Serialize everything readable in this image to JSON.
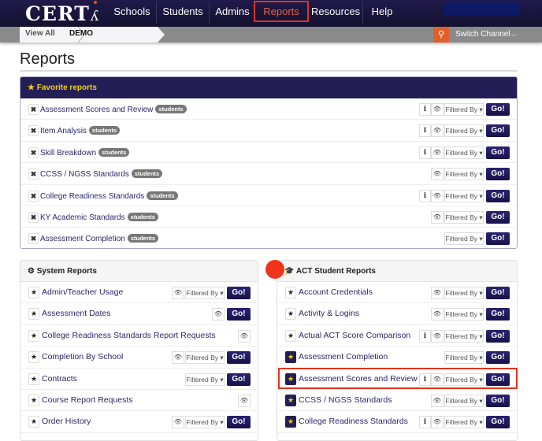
{
  "nav": {
    "logo": "CERT",
    "items": [
      "Schools",
      "Students",
      "Admins",
      "Reports",
      "Resources",
      "Help"
    ],
    "active": "Reports"
  },
  "breadcrumb": [
    "View All",
    "DEMO"
  ],
  "toolbar": {
    "search_icon": "search-icon",
    "switch_channel": "Switch Channel"
  },
  "page_title": "Reports",
  "favorites": {
    "title": "Favorite reports",
    "rows": [
      {
        "name": "Assessment Scores and Review",
        "badge": "students",
        "info": true,
        "eye": true,
        "filter": "Filtered By",
        "go": "Go!"
      },
      {
        "name": "Item Analysis",
        "badge": "students",
        "info": true,
        "eye": true,
        "filter": "Filtered By",
        "go": "Go!"
      },
      {
        "name": "Skill Breakdown",
        "badge": "students",
        "info": true,
        "eye": true,
        "filter": "Filtered By",
        "go": "Go!"
      },
      {
        "name": "CCSS / NGSS Standards",
        "badge": "students",
        "info": false,
        "eye": true,
        "filter": "Filtered By",
        "go": "Go!"
      },
      {
        "name": "College Readiness Standards",
        "badge": "students",
        "info": true,
        "eye": true,
        "filter": "Filtered By",
        "go": "Go!"
      },
      {
        "name": "KY Academic Standards",
        "badge": "students",
        "info": false,
        "eye": true,
        "filter": "Filtered By",
        "go": "Go!"
      },
      {
        "name": "Assessment Completion",
        "badge": "students",
        "info": false,
        "eye": false,
        "filter": "Filtered By",
        "go": "Go!"
      }
    ]
  },
  "system_reports": {
    "title": "System Reports",
    "rows": [
      {
        "name": "Admin/Teacher Usage",
        "fav": false,
        "info": false,
        "eye": true,
        "filter": "Filtered By",
        "go": "Go!"
      },
      {
        "name": "Assessment Dates",
        "fav": false,
        "info": false,
        "eye": true,
        "filter": null,
        "go": "Go!"
      },
      {
        "name": "College Readiness Standards Report Requests",
        "fav": false,
        "info": false,
        "eye": true,
        "filter": null,
        "go": null
      },
      {
        "name": "Completion By School",
        "fav": false,
        "info": false,
        "eye": true,
        "filter": "Filtered By",
        "go": "Go!"
      },
      {
        "name": "Contracts",
        "fav": false,
        "info": false,
        "eye": false,
        "filter": "Filtered By",
        "go": "Go!"
      },
      {
        "name": "Course Report Requests",
        "fav": false,
        "info": false,
        "eye": true,
        "filter": null,
        "go": null
      },
      {
        "name": "Order History",
        "fav": false,
        "info": false,
        "eye": true,
        "filter": "Filtered By",
        "go": "Go!"
      }
    ]
  },
  "act_reports": {
    "title": "ACT Student Reports",
    "rows": [
      {
        "name": "Account Credentials",
        "fav": false,
        "info": false,
        "eye": true,
        "filter": "Filtered By",
        "go": "Go!"
      },
      {
        "name": "Activity & Logins",
        "fav": false,
        "info": false,
        "eye": true,
        "filter": "Filtered By",
        "go": "Go!"
      },
      {
        "name": "Actual ACT Score Comparison",
        "fav": false,
        "info": true,
        "eye": true,
        "filter": "Filtered By",
        "go": "Go!"
      },
      {
        "name": "Assessment Completion",
        "fav": true,
        "info": false,
        "eye": false,
        "filter": "Filtered By",
        "go": "Go!"
      },
      {
        "name": "Assessment Scores and Review",
        "fav": true,
        "info": true,
        "eye": true,
        "filter": "Filtered By",
        "go": "Go!"
      },
      {
        "name": "CCSS / NGSS Standards",
        "fav": true,
        "info": false,
        "eye": true,
        "filter": "Filtered By",
        "go": "Go!"
      },
      {
        "name": "College Readiness Standards",
        "fav": true,
        "info": true,
        "eye": true,
        "filter": "Filtered By",
        "go": "Go!"
      }
    ]
  },
  "colors": {
    "nav_bg": "#1f1a4a",
    "accent_orange": "#e0602a",
    "highlight_red": "#e0341e",
    "favorite_yellow": "#f5d10d"
  }
}
